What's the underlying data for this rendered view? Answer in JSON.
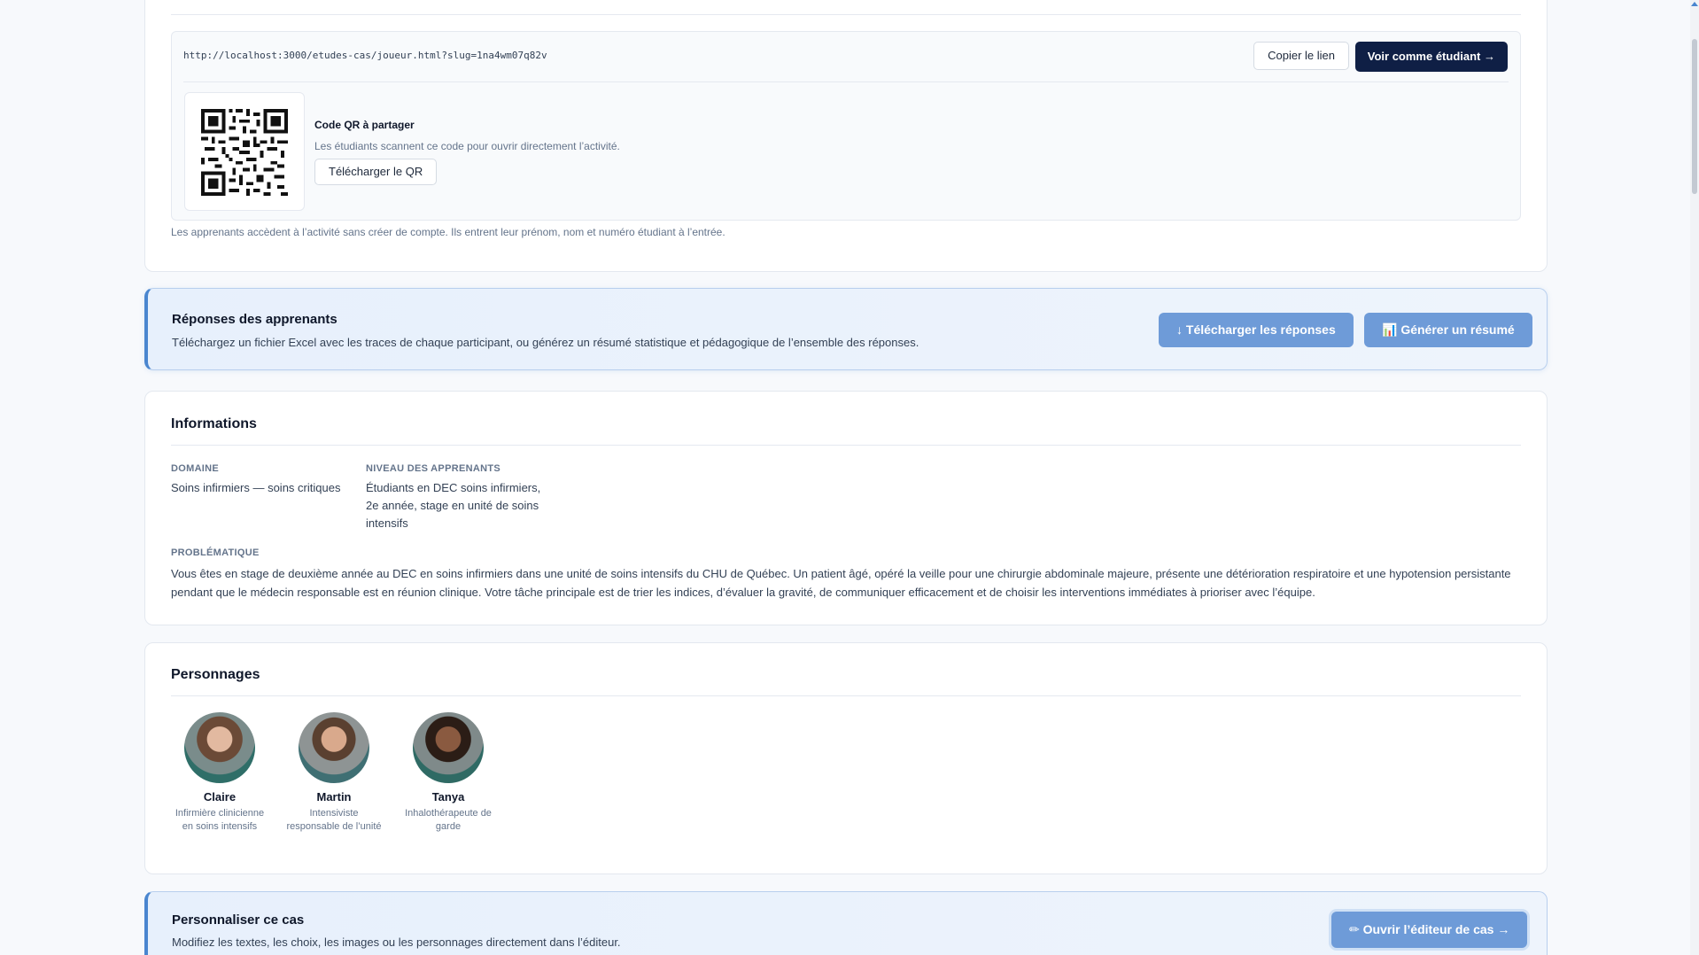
{
  "share": {
    "url": "http://localhost:3000/etudes-cas/joueur.html?slug=1na4wm07q82v",
    "copy_label": "Copier le lien",
    "view_label": "Voir comme étudiant →",
    "qr_title": "Code QR à partager",
    "qr_desc": "Les étudiants scannent ce code pour ouvrir directement l’activité.",
    "qr_download_label": "Télécharger le QR",
    "note": "Les apprenants accèdent à l’activité sans créer de compte. Ils entrent leur prénom, nom et numéro étudiant à l’entrée."
  },
  "responses": {
    "title": "Réponses des apprenants",
    "desc": "Téléchargez un fichier Excel avec les traces de chaque participant, ou générez un résumé statistique et pédagogique de l’ensemble des réponses.",
    "download_label": "↓ Télécharger les réponses",
    "summary_label": "📊 Générer un résumé"
  },
  "info": {
    "title": "Informations",
    "domain_label": "DOMAINE",
    "domain_value": "Soins infirmiers — soins critiques",
    "level_label": "NIVEAU DES APPRENANTS",
    "level_value": "Étudiants en DEC soins infirmiers, 2e année, stage en unité de soins intensifs",
    "problem_label": "PROBLÉMATIQUE",
    "problem_value": "Vous êtes en stage de deuxième année au DEC en soins infirmiers dans une unité de soins intensifs du CHU de Québec. Un patient âgé, opéré la veille pour une chirurgie abdominale majeure, présente une détérioration respiratoire et une hypotension persistante pendant que le médecin responsable est en réunion clinique. Votre tâche principale est de trier les indices, d’évaluer la gravité, de communiquer efficacement et de choisir les interventions immédiates à prioriser avec l’équipe."
  },
  "characters": {
    "title": "Personnages",
    "items": [
      {
        "name": "Claire",
        "role": "Infirmière clinicienne en soins intensifs"
      },
      {
        "name": "Martin",
        "role": "Intensiviste responsable de l’unité"
      },
      {
        "name": "Tanya",
        "role": "Inhalothérapeute de garde"
      }
    ]
  },
  "customize": {
    "title": "Personnaliser ce cas",
    "desc": "Modifiez les textes, les choix, les images ou les personnages directement dans l’éditeur.",
    "open_label": "✏ Ouvrir l’éditeur de cas →"
  },
  "colors": {
    "primary_dark": "#0f1f45",
    "accent_blue": "#6e9bd8",
    "banner_border": "#4a86cf"
  }
}
